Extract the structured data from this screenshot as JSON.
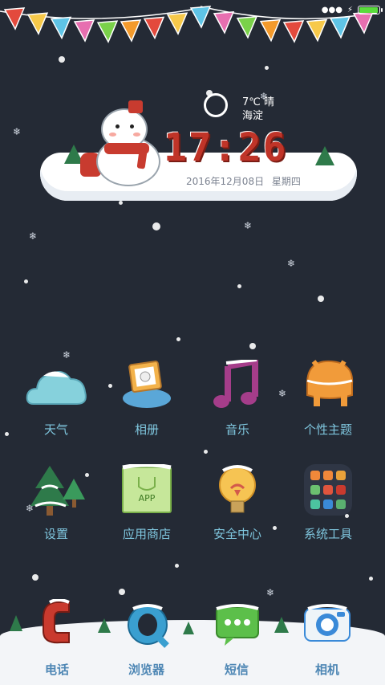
{
  "status_bar": {
    "battery_level": 1.0,
    "icons": [
      "dots-icon",
      "charging-icon",
      "battery-icon"
    ]
  },
  "decor": {
    "bunting_colors": [
      "#e34a3d",
      "#f7c94a",
      "#5fc4e6",
      "#e76fb0",
      "#7ad14a",
      "#f39a2c"
    ]
  },
  "widget": {
    "weather": {
      "temp": "7℃ 晴",
      "location": "海淀"
    },
    "time": "17:26",
    "date": "2016年12月08日  星期四"
  },
  "apps": [
    {
      "id": "weather",
      "label": "天气",
      "icon": "cloud-icon"
    },
    {
      "id": "gallery",
      "label": "相册",
      "icon": "photo-frame-icon"
    },
    {
      "id": "music",
      "label": "音乐",
      "icon": "music-note-icon"
    },
    {
      "id": "themes",
      "label": "个性主题",
      "icon": "theme-icon"
    },
    {
      "id": "settings",
      "label": "设置",
      "icon": "tree-icon"
    },
    {
      "id": "store",
      "label": "应用商店",
      "icon": "app-store-bag-icon",
      "badge": "APP"
    },
    {
      "id": "security",
      "label": "安全中心",
      "icon": "lightbulb-icon"
    },
    {
      "id": "tools",
      "label": "系统工具",
      "icon": "tools-folder-icon"
    }
  ],
  "dock": [
    {
      "id": "phone",
      "label": "电话",
      "icon": "phone-icon"
    },
    {
      "id": "browser",
      "label": "浏览器",
      "icon": "browser-icon"
    },
    {
      "id": "sms",
      "label": "短信",
      "icon": "message-icon"
    },
    {
      "id": "camera",
      "label": "相机",
      "icon": "camera-icon"
    }
  ],
  "colors": {
    "background": "#242a35",
    "app_label": "#7fc6de",
    "dock_label": "#4d86b4",
    "clock": "#c03428"
  }
}
